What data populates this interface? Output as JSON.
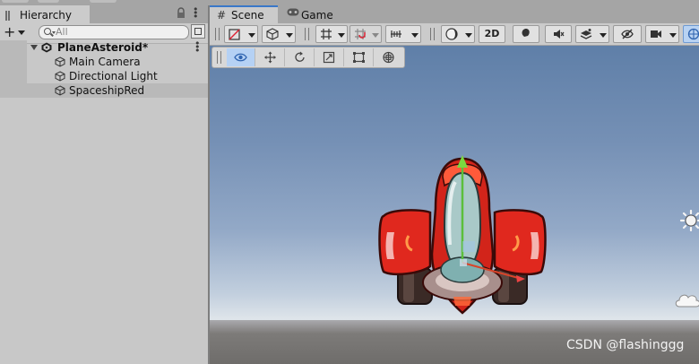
{
  "hierarchy": {
    "tab_label": "Hierarchy",
    "search_placeholder": "All",
    "items": [
      {
        "label": "PlaneAsteroid*"
      },
      {
        "label": "Main Camera"
      },
      {
        "label": "Directional Light"
      },
      {
        "label": "SpaceshipRed"
      }
    ]
  },
  "scene": {
    "tabs": [
      {
        "label": "Scene"
      },
      {
        "label": "Game"
      }
    ],
    "toolbar": {
      "mode_2d": "2D"
    },
    "watermark": "CSDN @flashinggg"
  },
  "colors": {
    "accent": "#3a78c8",
    "tool_active": "#b5d1f4",
    "ship_red": "#e0281e"
  }
}
